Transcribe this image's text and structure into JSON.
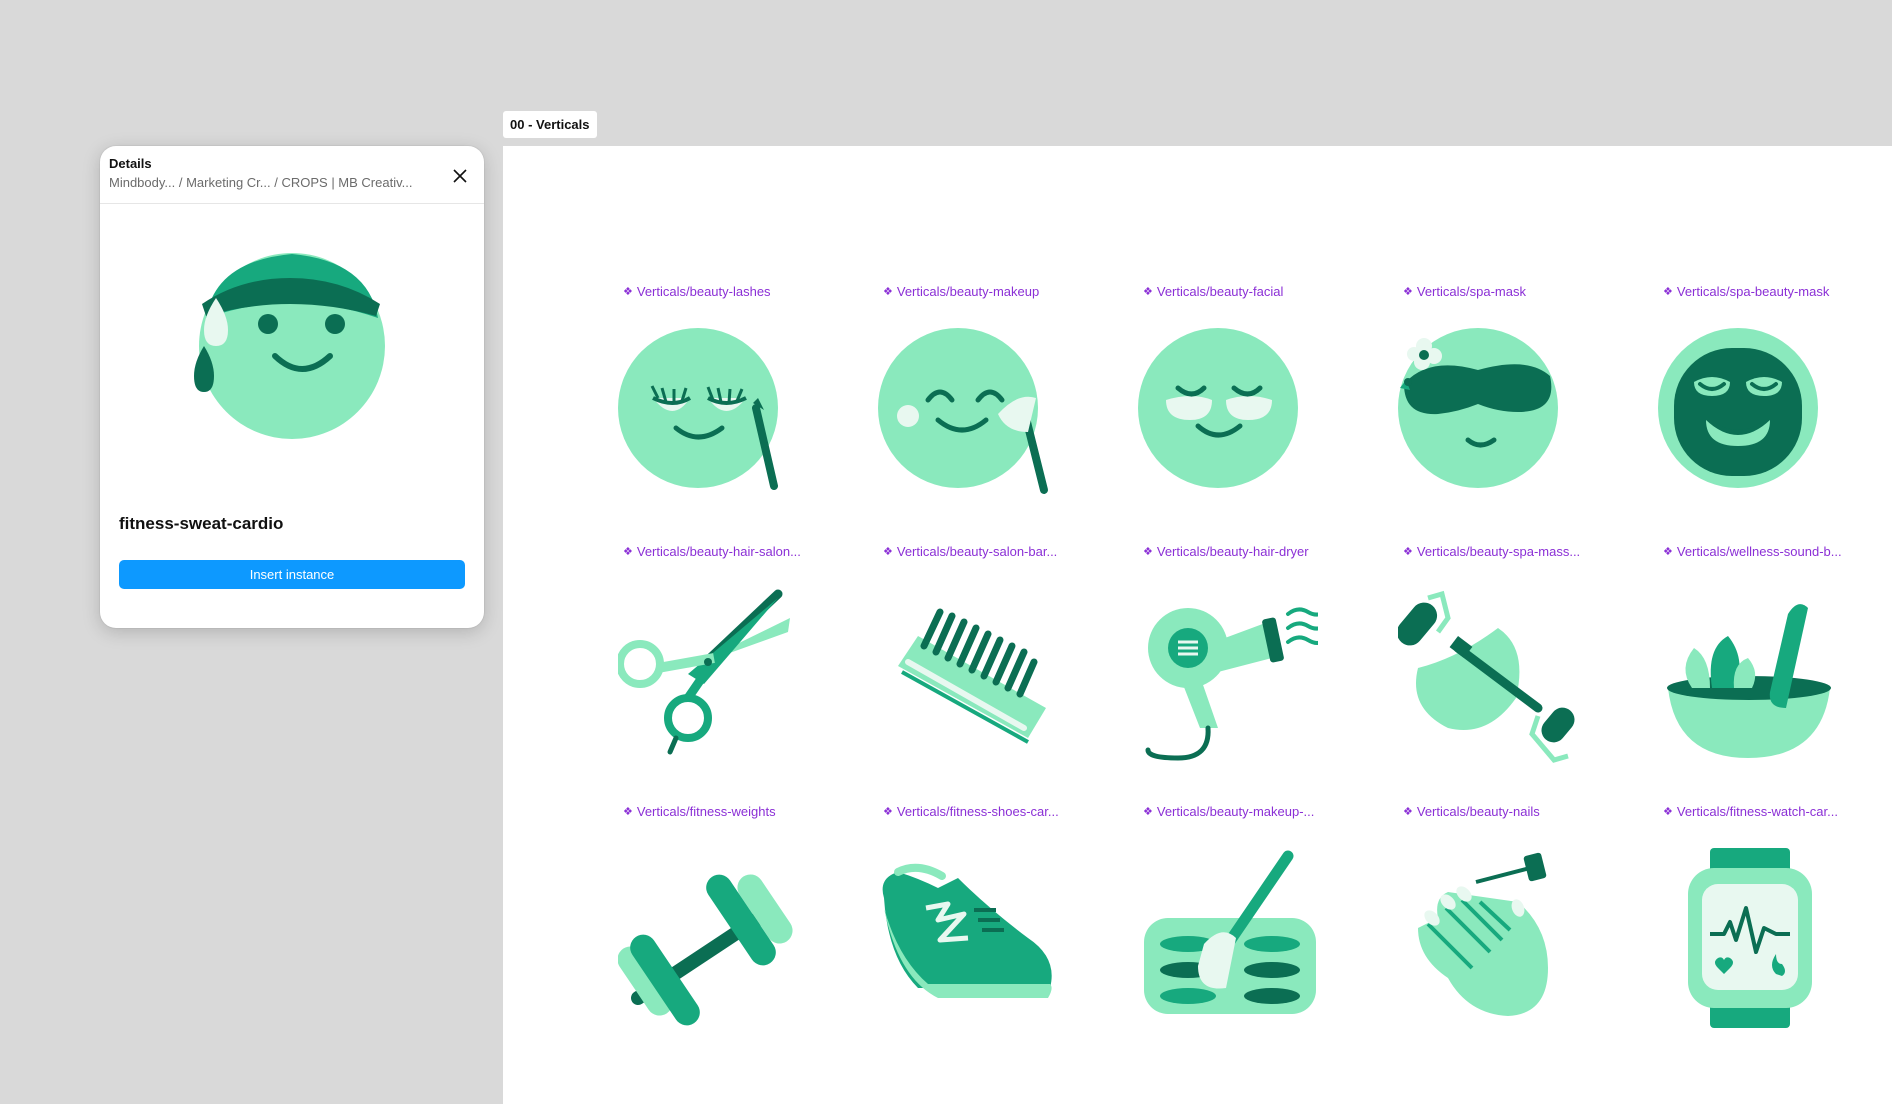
{
  "frame": {
    "label": "00 - Verticals"
  },
  "details": {
    "title": "Details",
    "breadcrumb": [
      "Mindbody...",
      "/ Marketing Cr...",
      "/ CROPS | MB Creativ..."
    ],
    "component_name": "fitness-sweat-cardio",
    "insert_label": "Insert instance"
  },
  "components": [
    {
      "label": "Verticals/beauty-lashes",
      "icon": "beauty-lashes-icon"
    },
    {
      "label": "Verticals/beauty-makeup",
      "icon": "beauty-makeup-icon"
    },
    {
      "label": "Verticals/beauty-facial",
      "icon": "beauty-facial-icon"
    },
    {
      "label": "Verticals/spa-mask",
      "icon": "spa-mask-icon"
    },
    {
      "label": "Verticals/spa-beauty-mask",
      "icon": "spa-beauty-mask-icon"
    },
    {
      "label": "Verticals/beauty-hair-salon...",
      "icon": "scissors-icon"
    },
    {
      "label": "Verticals/beauty-salon-bar...",
      "icon": "comb-icon"
    },
    {
      "label": "Verticals/beauty-hair-dryer",
      "icon": "hair-dryer-icon"
    },
    {
      "label": "Verticals/beauty-spa-mass...",
      "icon": "face-roller-icon"
    },
    {
      "label": "Verticals/wellness-sound-b...",
      "icon": "singing-bowl-icon"
    },
    {
      "label": "Verticals/fitness-weights",
      "icon": "dumbbell-icon"
    },
    {
      "label": "Verticals/fitness-shoes-car...",
      "icon": "running-shoe-icon"
    },
    {
      "label": "Verticals/beauty-makeup-...",
      "icon": "makeup-palette-icon"
    },
    {
      "label": "Verticals/beauty-nails",
      "icon": "nail-polish-icon"
    },
    {
      "label": "Verticals/fitness-watch-car...",
      "icon": "fitness-watch-icon"
    }
  ],
  "colors": {
    "light_green": "#8ae9bd",
    "mid_green": "#17a97e",
    "dark_green": "#0b6e53",
    "pale": "#e8f8f0",
    "label_purple": "#8b2fd6",
    "button_blue": "#0d99ff"
  }
}
